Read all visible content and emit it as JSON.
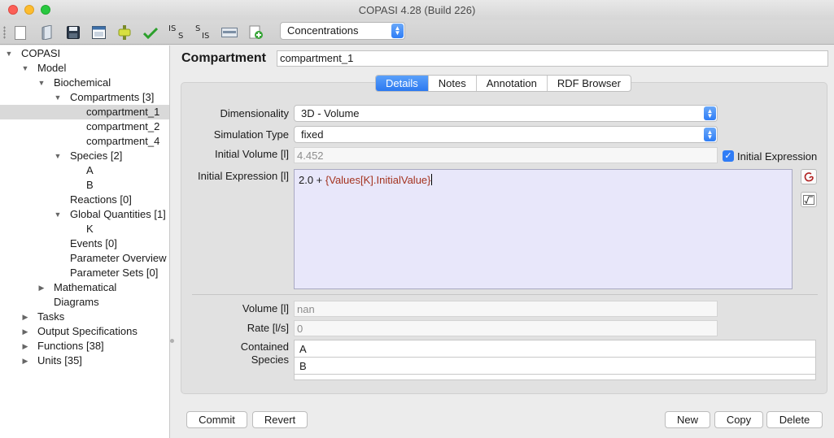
{
  "window": {
    "title": "COPASI 4.28 (Build 226)"
  },
  "toolbar": {
    "icons": [
      "new-file-icon",
      "open-file-icon",
      "save-icon",
      "save-as-icon",
      "check-model-icon",
      "checkmark-icon",
      "is-s-icon",
      "s-is-icon",
      "sbml-icon",
      "add-icon"
    ],
    "is_s_label_top": "IS",
    "is_s_label_bottom": "S",
    "s_is_label_top": "S",
    "s_is_label_bottom": "IS",
    "mode_select": "Concentrations"
  },
  "tree": {
    "root": "COPASI",
    "model": "Model",
    "biochemical": "Biochemical",
    "compartments": "Compartments [3]",
    "compartment_1": "compartment_1",
    "compartment_2": "compartment_2",
    "compartment_4": "compartment_4",
    "species": "Species [2]",
    "species_a": "A",
    "species_b": "B",
    "reactions": "Reactions [0]",
    "global_quantities": "Global Quantities [1]",
    "gq_k": "K",
    "events": "Events [0]",
    "parameter_overview": "Parameter Overview",
    "parameter_sets": "Parameter Sets [0]",
    "mathematical": "Mathematical",
    "diagrams": "Diagrams",
    "tasks": "Tasks",
    "output_specifications": "Output Specifications",
    "functions": "Functions [38]",
    "units": "Units [35]"
  },
  "main": {
    "title": "Compartment",
    "name_value": "compartment_1",
    "tabs": [
      "Details",
      "Notes",
      "Annotation",
      "RDF Browser"
    ],
    "dimensionality_label": "Dimensionality",
    "dimensionality_value": "3D - Volume",
    "simulation_type_label": "Simulation Type",
    "simulation_type_value": "fixed",
    "initial_volume_label": "Initial Volume [l]",
    "initial_volume_value": "4.452",
    "initial_expression_check_label": "Initial Expression",
    "initial_expression_label": "Initial Expression [l]",
    "expression_prefix": "2.0 + ",
    "expression_ref": "{Values[K].InitialValue}",
    "volume_label": "Volume [l]",
    "volume_value": "nan",
    "rate_label": "Rate [l/s]",
    "rate_value": "0",
    "contained_species_label_1": "Contained",
    "contained_species_label_2": "Species",
    "contained_species": [
      "A",
      "B"
    ]
  },
  "buttons": {
    "commit": "Commit",
    "revert": "Revert",
    "new": "New",
    "copy": "Copy",
    "delete": "Delete"
  },
  "colors": {
    "accent": "#2f7cf6",
    "expression_bg": "#e8e7fa",
    "expression_ref": "#a4331f",
    "selected_row": "#d9d9d9"
  }
}
